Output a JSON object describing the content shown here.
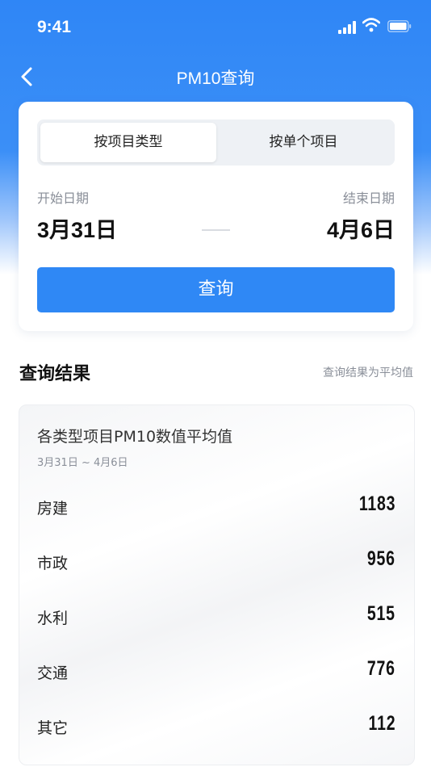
{
  "status_bar": {
    "time": "9:41"
  },
  "nav": {
    "title": "PM10查询"
  },
  "tabs": {
    "by_type": "按项目类型",
    "by_single": "按单个项目"
  },
  "dates": {
    "start_label": "开始日期",
    "start_value": "3月31日",
    "end_label": "结束日期",
    "end_value": "4月6日"
  },
  "query_button": "查询",
  "results": {
    "title": "查询结果",
    "note": "查询结果为平均值",
    "card_title": "各类型项目PM10数值平均值",
    "range": "3月31日 ~ 4月6日",
    "rows": [
      {
        "label": "房建",
        "value": "1183"
      },
      {
        "label": "市政",
        "value": "956"
      },
      {
        "label": "水利",
        "value": "515"
      },
      {
        "label": "交通",
        "value": "776"
      },
      {
        "label": "其它",
        "value": "112"
      }
    ]
  },
  "colors": {
    "brand": "#2f88f5",
    "header_top": "#2f86f6"
  }
}
